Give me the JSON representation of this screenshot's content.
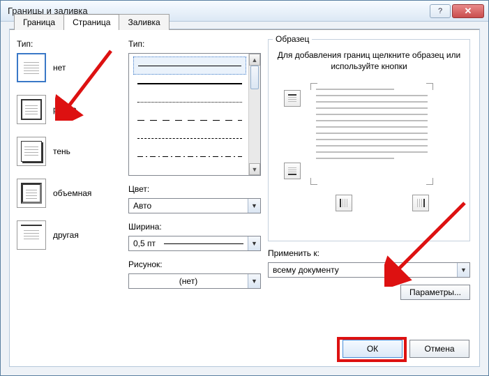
{
  "title": "Границы и заливка",
  "tabs": {
    "borders": "Граница",
    "page": "Страница",
    "shading": "Заливка"
  },
  "col1": {
    "label": "Тип:",
    "options": {
      "none": "нет",
      "box": "рамка",
      "shadow": "тень",
      "threeD": "объемная",
      "custom": "другая"
    }
  },
  "col2": {
    "style_label": "Тип:",
    "color_label": "Цвет:",
    "color_value": "Авто",
    "width_label": "Ширина:",
    "width_value": "0,5 пт",
    "art_label": "Рисунок:",
    "art_value": "(нет)"
  },
  "col3": {
    "preview_label": "Образец",
    "preview_hint": "Для добавления границ щелкните образец или используйте кнопки",
    "apply_label": "Применить к:",
    "apply_value": "всему документу",
    "params_btn": "Параметры..."
  },
  "buttons": {
    "ok": "ОК",
    "cancel": "Отмена"
  },
  "winbtns": {
    "help": "?",
    "close": "✕"
  }
}
